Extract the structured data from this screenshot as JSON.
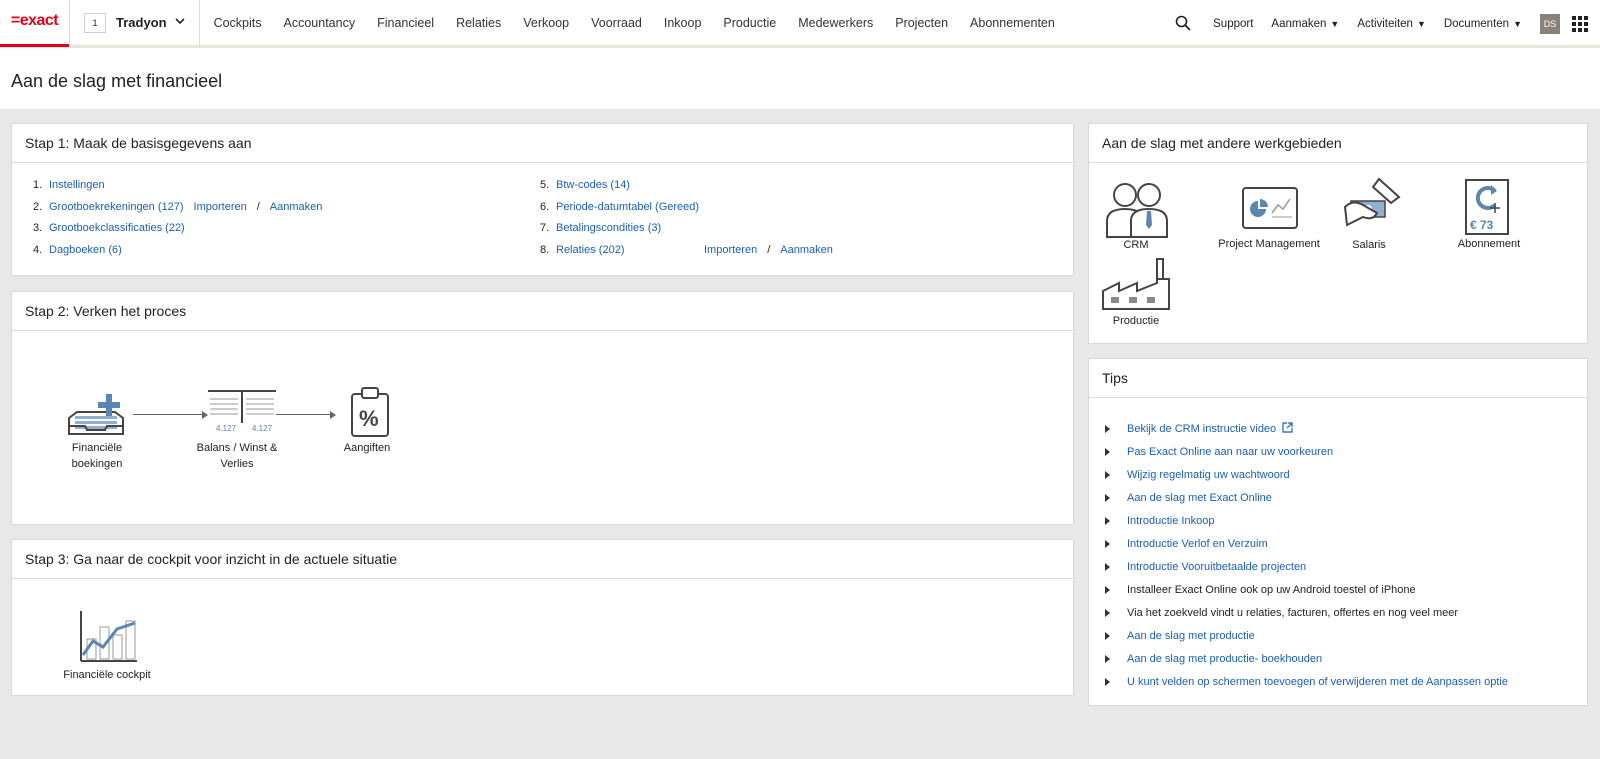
{
  "header": {
    "logo": "=exact",
    "company_number": "1",
    "company_name": "Tradyon",
    "nav": [
      "Cockpits",
      "Accountancy",
      "Financieel",
      "Relaties",
      "Verkoop",
      "Voorraad",
      "Inkoop",
      "Productie",
      "Medewerkers",
      "Projecten",
      "Abonnementen"
    ],
    "support": "Support",
    "create": "Aanmaken",
    "activities": "Activiteiten",
    "documents": "Documenten",
    "avatar": "DS"
  },
  "page": {
    "title": "Aan de slag met financieel"
  },
  "step1": {
    "title": "Stap 1: Maak de basisgegevens aan",
    "left": [
      {
        "n": "1.",
        "label": "Instellingen"
      },
      {
        "n": "2.",
        "label": "Grootboekrekeningen (127)",
        "import": "Importeren",
        "sep": "/",
        "create": "Aanmaken"
      },
      {
        "n": "3.",
        "label": "Grootboekclassificaties (22)"
      },
      {
        "n": "4.",
        "label": "Dagboeken (6)"
      }
    ],
    "right": [
      {
        "n": "5.",
        "label": "Btw-codes (14)"
      },
      {
        "n": "6.",
        "label": "Periode-datumtabel (Gereed)"
      },
      {
        "n": "7.",
        "label": "Betalingscondities (3)"
      },
      {
        "n": "8.",
        "label": "Relaties (202)",
        "import": "Importeren",
        "sep": "/",
        "create": "Aanmaken"
      }
    ]
  },
  "step2": {
    "title": "Stap 2: Verken het proces",
    "items": [
      "Financiële boekingen",
      "Balans / Winst & Verlies",
      "Aangiften"
    ],
    "balance_numbers": [
      "4.127",
      "4.127"
    ]
  },
  "step3": {
    "title": "Stap 3: Ga naar de cockpit voor inzicht in de actuele situatie",
    "item": "Financiële cockpit"
  },
  "areas": {
    "title": "Aan de slag met andere werkgebieden",
    "items": [
      "CRM",
      "Project Management",
      "Salaris",
      "Abonnement",
      "Productie"
    ],
    "abonnement_amount": "€ 73"
  },
  "tips": {
    "title": "Tips",
    "items": [
      {
        "label": "Bekijk de CRM instructie video",
        "link": true,
        "external": true
      },
      {
        "label": "Pas Exact Online aan naar uw voorkeuren",
        "link": true
      },
      {
        "label": "Wijzig regelmatig uw wachtwoord",
        "link": true
      },
      {
        "label": "Aan de slag met Exact Online",
        "link": true
      },
      {
        "label": "Introductie Inkoop",
        "link": true
      },
      {
        "label": "Introductie Verlof en Verzuim",
        "link": true
      },
      {
        "label": "Introductie Vooruitbetaalde projecten",
        "link": true
      },
      {
        "label": "Installeer Exact Online ook op uw Android toestel of iPhone",
        "link": false
      },
      {
        "label": "Via het zoekveld vindt u relaties, facturen, offertes en nog veel meer",
        "link": false
      },
      {
        "label": "Aan de slag met productie",
        "link": true
      },
      {
        "label": "Aan de slag met productie- boekhouden",
        "link": true
      },
      {
        "label": "U kunt velden op schermen toevoegen of verwijderen met de Aanpassen optie",
        "link": true
      }
    ]
  },
  "colors": {
    "brand": "#e2001a",
    "link": "#1a5fb4",
    "icon": "#5b86b0"
  }
}
